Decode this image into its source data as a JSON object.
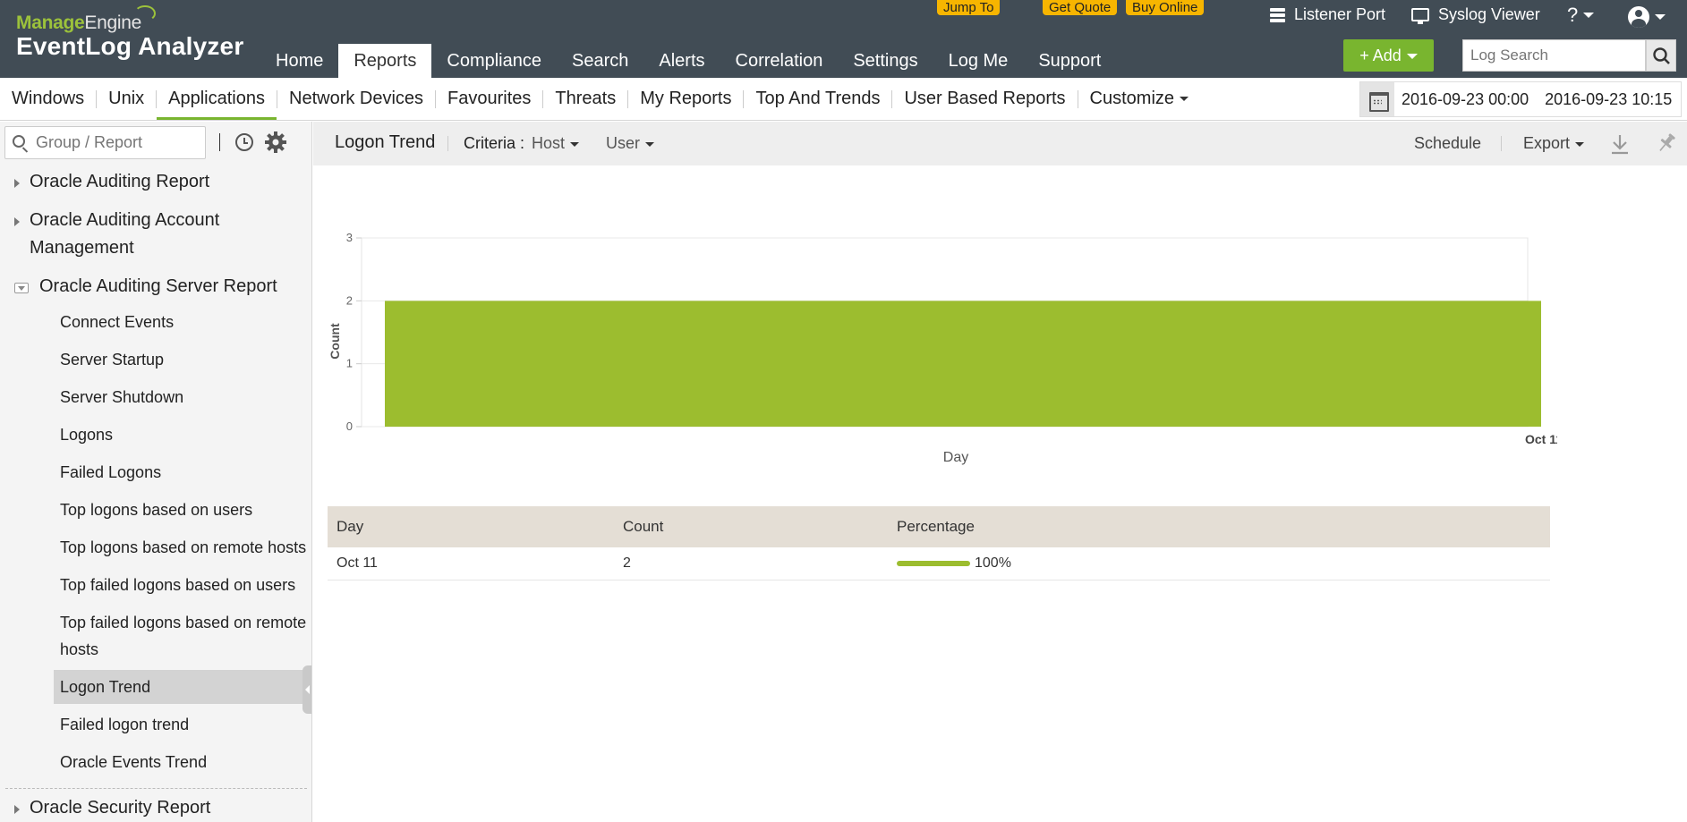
{
  "header": {
    "brand_manage": "Manage",
    "brand_engine": "Engine",
    "product": "EventLog Analyzer",
    "promos": [
      "Jump To",
      "Get Quote",
      "Buy Online"
    ],
    "nav": [
      "Home",
      "Reports",
      "Compliance",
      "Search",
      "Alerts",
      "Correlation",
      "Settings",
      "Log Me",
      "Support"
    ],
    "active_nav": "Reports",
    "listener_port": "Listener Port",
    "syslog_viewer": "Syslog Viewer",
    "help": "?",
    "add_label": "+ Add",
    "log_search_placeholder": "Log Search"
  },
  "subnav": {
    "tabs": [
      "Windows",
      "Unix",
      "Applications",
      "Network Devices",
      "Favourites",
      "Threats",
      "My Reports",
      "Top And Trends",
      "User Based Reports",
      "Customize"
    ],
    "active_tab": "Applications",
    "date_from": "2016-09-23 00:00",
    "date_to": "2016-09-23 10:15"
  },
  "sidebar": {
    "search_placeholder": "Group / Report",
    "groups": [
      {
        "label": "Oracle Auditing Report",
        "expanded": false
      },
      {
        "label": "Oracle Auditing Account Management",
        "expanded": false
      },
      {
        "label": "Oracle Auditing Server Report",
        "expanded": true
      }
    ],
    "items": [
      "Connect Events",
      "Server Startup",
      "Server Shutdown",
      "Logons",
      "Failed Logons",
      "Top logons based on users",
      "Top logons based on remote hosts",
      "Top failed logons based on users",
      "Top failed logons based on remote hosts",
      "Logon Trend",
      "Failed logon trend",
      "Oracle Events Trend"
    ],
    "selected_item": "Logon Trend",
    "next_group": "Oracle Security Report"
  },
  "report": {
    "title": "Logon Trend",
    "criteria_label": "Criteria :",
    "criteria_host": "Host",
    "criteria_user": "User",
    "schedule": "Schedule",
    "export": "Export"
  },
  "chart_data": {
    "type": "area",
    "x": [
      "Oct 11"
    ],
    "values": [
      2
    ],
    "xlabel": "Day",
    "ylabel": "Count",
    "yticks": [
      0,
      1,
      2,
      3
    ],
    "ylim": [
      0,
      3
    ],
    "color": "#9cbd2f"
  },
  "table": {
    "columns": [
      "Day",
      "Count",
      "Percentage"
    ],
    "rows": [
      {
        "day": "Oct 11",
        "count": "2",
        "percentage": "100%",
        "percent_value": 100
      }
    ]
  },
  "colors": {
    "header_bg": "#414c55",
    "accent_green": "#79b52f",
    "promo_yellow": "#f7b500"
  }
}
